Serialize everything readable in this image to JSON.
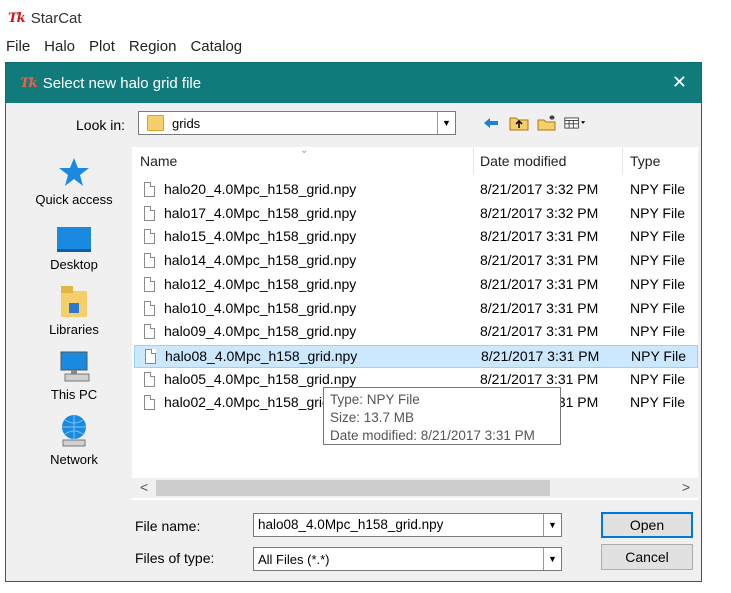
{
  "app": {
    "title": "StarCat",
    "logo_text": "Tk"
  },
  "menubar": [
    "File",
    "Halo",
    "Plot",
    "Region",
    "Catalog"
  ],
  "dialog": {
    "title": "Select new halo grid file",
    "close_glyph": "✕",
    "look_in_label": "Look in:",
    "look_in_value": "grids",
    "places": [
      "Quick access",
      "Desktop",
      "Libraries",
      "This PC",
      "Network"
    ],
    "columns": {
      "name": "Name",
      "date": "Date modified",
      "type": "Type"
    },
    "files": [
      {
        "name": "halo20_4.0Mpc_h158_grid.npy",
        "date": "8/21/2017 3:32 PM",
        "type": "NPY File"
      },
      {
        "name": "halo17_4.0Mpc_h158_grid.npy",
        "date": "8/21/2017 3:32 PM",
        "type": "NPY File"
      },
      {
        "name": "halo15_4.0Mpc_h158_grid.npy",
        "date": "8/21/2017 3:31 PM",
        "type": "NPY File"
      },
      {
        "name": "halo14_4.0Mpc_h158_grid.npy",
        "date": "8/21/2017 3:31 PM",
        "type": "NPY File"
      },
      {
        "name": "halo12_4.0Mpc_h158_grid.npy",
        "date": "8/21/2017 3:31 PM",
        "type": "NPY File"
      },
      {
        "name": "halo10_4.0Mpc_h158_grid.npy",
        "date": "8/21/2017 3:31 PM",
        "type": "NPY File"
      },
      {
        "name": "halo09_4.0Mpc_h158_grid.npy",
        "date": "8/21/2017 3:31 PM",
        "type": "NPY File"
      },
      {
        "name": "halo08_4.0Mpc_h158_grid.npy",
        "date": "8/21/2017 3:31 PM",
        "type": "NPY File"
      },
      {
        "name": "halo05_4.0Mpc_h158_grid.npy",
        "date": "8/21/2017 3:31 PM",
        "type": "NPY File"
      },
      {
        "name": "halo02_4.0Mpc_h158_grid.npy",
        "date": "8/21/2017 3:31 PM",
        "type": "NPY File"
      }
    ],
    "selected_index": 7,
    "tooltip": {
      "type_line": "Type: NPY File",
      "size_line": "Size: 13.7 MB",
      "date_line": "Date modified: 8/21/2017 3:31 PM"
    },
    "file_name_label": "File name:",
    "file_name_value": "halo08_4.0Mpc_h158_grid.npy",
    "file_type_label": "Files of type:",
    "file_type_value": "All Files (*.*)",
    "open_label": "Open",
    "cancel_label": "Cancel"
  },
  "colors": {
    "titlebar": "#117b7b",
    "selection": "#cce8ff",
    "default_button_border": "#0078d7"
  },
  "icons": [
    "tk-logo",
    "folder-icon",
    "back-arrow-icon",
    "up-folder-icon",
    "new-folder-icon",
    "view-menu-icon",
    "quick-access-star-icon",
    "desktop-icon",
    "libraries-icon",
    "this-pc-icon",
    "network-icon",
    "file-icon"
  ]
}
